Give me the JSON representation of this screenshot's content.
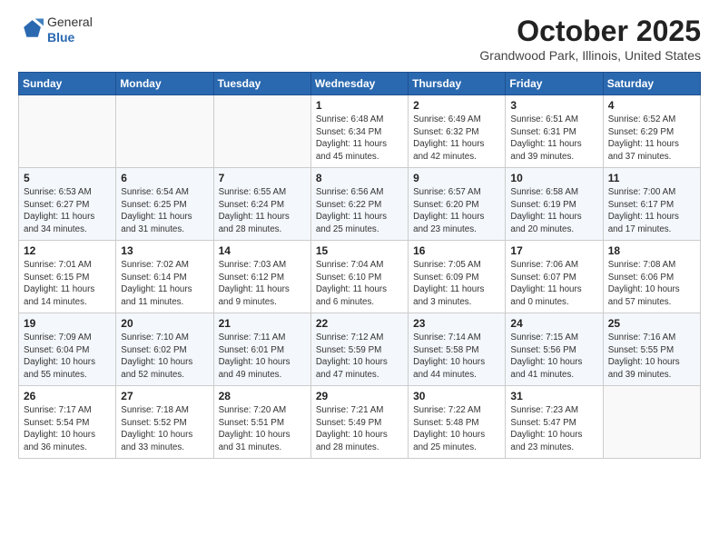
{
  "header": {
    "logo_line1": "General",
    "logo_line2": "Blue",
    "month": "October 2025",
    "location": "Grandwood Park, Illinois, United States"
  },
  "weekdays": [
    "Sunday",
    "Monday",
    "Tuesday",
    "Wednesday",
    "Thursday",
    "Friday",
    "Saturday"
  ],
  "weeks": [
    [
      {
        "day": "",
        "info": ""
      },
      {
        "day": "",
        "info": ""
      },
      {
        "day": "",
        "info": ""
      },
      {
        "day": "1",
        "info": "Sunrise: 6:48 AM\nSunset: 6:34 PM\nDaylight: 11 hours\nand 45 minutes."
      },
      {
        "day": "2",
        "info": "Sunrise: 6:49 AM\nSunset: 6:32 PM\nDaylight: 11 hours\nand 42 minutes."
      },
      {
        "day": "3",
        "info": "Sunrise: 6:51 AM\nSunset: 6:31 PM\nDaylight: 11 hours\nand 39 minutes."
      },
      {
        "day": "4",
        "info": "Sunrise: 6:52 AM\nSunset: 6:29 PM\nDaylight: 11 hours\nand 37 minutes."
      }
    ],
    [
      {
        "day": "5",
        "info": "Sunrise: 6:53 AM\nSunset: 6:27 PM\nDaylight: 11 hours\nand 34 minutes."
      },
      {
        "day": "6",
        "info": "Sunrise: 6:54 AM\nSunset: 6:25 PM\nDaylight: 11 hours\nand 31 minutes."
      },
      {
        "day": "7",
        "info": "Sunrise: 6:55 AM\nSunset: 6:24 PM\nDaylight: 11 hours\nand 28 minutes."
      },
      {
        "day": "8",
        "info": "Sunrise: 6:56 AM\nSunset: 6:22 PM\nDaylight: 11 hours\nand 25 minutes."
      },
      {
        "day": "9",
        "info": "Sunrise: 6:57 AM\nSunset: 6:20 PM\nDaylight: 11 hours\nand 23 minutes."
      },
      {
        "day": "10",
        "info": "Sunrise: 6:58 AM\nSunset: 6:19 PM\nDaylight: 11 hours\nand 20 minutes."
      },
      {
        "day": "11",
        "info": "Sunrise: 7:00 AM\nSunset: 6:17 PM\nDaylight: 11 hours\nand 17 minutes."
      }
    ],
    [
      {
        "day": "12",
        "info": "Sunrise: 7:01 AM\nSunset: 6:15 PM\nDaylight: 11 hours\nand 14 minutes."
      },
      {
        "day": "13",
        "info": "Sunrise: 7:02 AM\nSunset: 6:14 PM\nDaylight: 11 hours\nand 11 minutes."
      },
      {
        "day": "14",
        "info": "Sunrise: 7:03 AM\nSunset: 6:12 PM\nDaylight: 11 hours\nand 9 minutes."
      },
      {
        "day": "15",
        "info": "Sunrise: 7:04 AM\nSunset: 6:10 PM\nDaylight: 11 hours\nand 6 minutes."
      },
      {
        "day": "16",
        "info": "Sunrise: 7:05 AM\nSunset: 6:09 PM\nDaylight: 11 hours\nand 3 minutes."
      },
      {
        "day": "17",
        "info": "Sunrise: 7:06 AM\nSunset: 6:07 PM\nDaylight: 11 hours\nand 0 minutes."
      },
      {
        "day": "18",
        "info": "Sunrise: 7:08 AM\nSunset: 6:06 PM\nDaylight: 10 hours\nand 57 minutes."
      }
    ],
    [
      {
        "day": "19",
        "info": "Sunrise: 7:09 AM\nSunset: 6:04 PM\nDaylight: 10 hours\nand 55 minutes."
      },
      {
        "day": "20",
        "info": "Sunrise: 7:10 AM\nSunset: 6:02 PM\nDaylight: 10 hours\nand 52 minutes."
      },
      {
        "day": "21",
        "info": "Sunrise: 7:11 AM\nSunset: 6:01 PM\nDaylight: 10 hours\nand 49 minutes."
      },
      {
        "day": "22",
        "info": "Sunrise: 7:12 AM\nSunset: 5:59 PM\nDaylight: 10 hours\nand 47 minutes."
      },
      {
        "day": "23",
        "info": "Sunrise: 7:14 AM\nSunset: 5:58 PM\nDaylight: 10 hours\nand 44 minutes."
      },
      {
        "day": "24",
        "info": "Sunrise: 7:15 AM\nSunset: 5:56 PM\nDaylight: 10 hours\nand 41 minutes."
      },
      {
        "day": "25",
        "info": "Sunrise: 7:16 AM\nSunset: 5:55 PM\nDaylight: 10 hours\nand 39 minutes."
      }
    ],
    [
      {
        "day": "26",
        "info": "Sunrise: 7:17 AM\nSunset: 5:54 PM\nDaylight: 10 hours\nand 36 minutes."
      },
      {
        "day": "27",
        "info": "Sunrise: 7:18 AM\nSunset: 5:52 PM\nDaylight: 10 hours\nand 33 minutes."
      },
      {
        "day": "28",
        "info": "Sunrise: 7:20 AM\nSunset: 5:51 PM\nDaylight: 10 hours\nand 31 minutes."
      },
      {
        "day": "29",
        "info": "Sunrise: 7:21 AM\nSunset: 5:49 PM\nDaylight: 10 hours\nand 28 minutes."
      },
      {
        "day": "30",
        "info": "Sunrise: 7:22 AM\nSunset: 5:48 PM\nDaylight: 10 hours\nand 25 minutes."
      },
      {
        "day": "31",
        "info": "Sunrise: 7:23 AM\nSunset: 5:47 PM\nDaylight: 10 hours\nand 23 minutes."
      },
      {
        "day": "",
        "info": ""
      }
    ]
  ]
}
